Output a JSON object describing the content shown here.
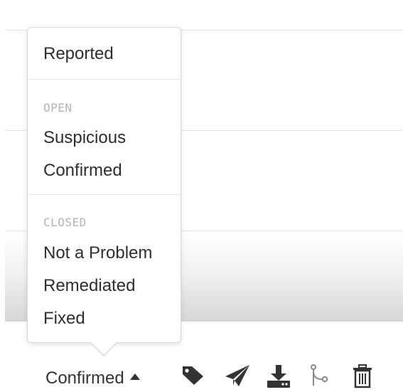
{
  "menu": {
    "items_top": [
      {
        "label": "Reported"
      }
    ],
    "group_open": {
      "header": "OPEN",
      "items": [
        {
          "label": "Suspicious"
        },
        {
          "label": "Confirmed"
        }
      ]
    },
    "group_closed": {
      "header": "CLOSED",
      "items": [
        {
          "label": "Not a Problem"
        },
        {
          "label": "Remediated"
        },
        {
          "label": "Fixed"
        }
      ]
    }
  },
  "toolbar": {
    "status_label": "Confirmed",
    "icons": [
      "tag-icon",
      "send-icon",
      "download-icon",
      "branch-icon",
      "trash-icon"
    ]
  },
  "colors": {
    "text": "#333333",
    "muted_header": "#b3b3b3",
    "icon": "#333333",
    "icon_light": "#8a8a8a"
  }
}
